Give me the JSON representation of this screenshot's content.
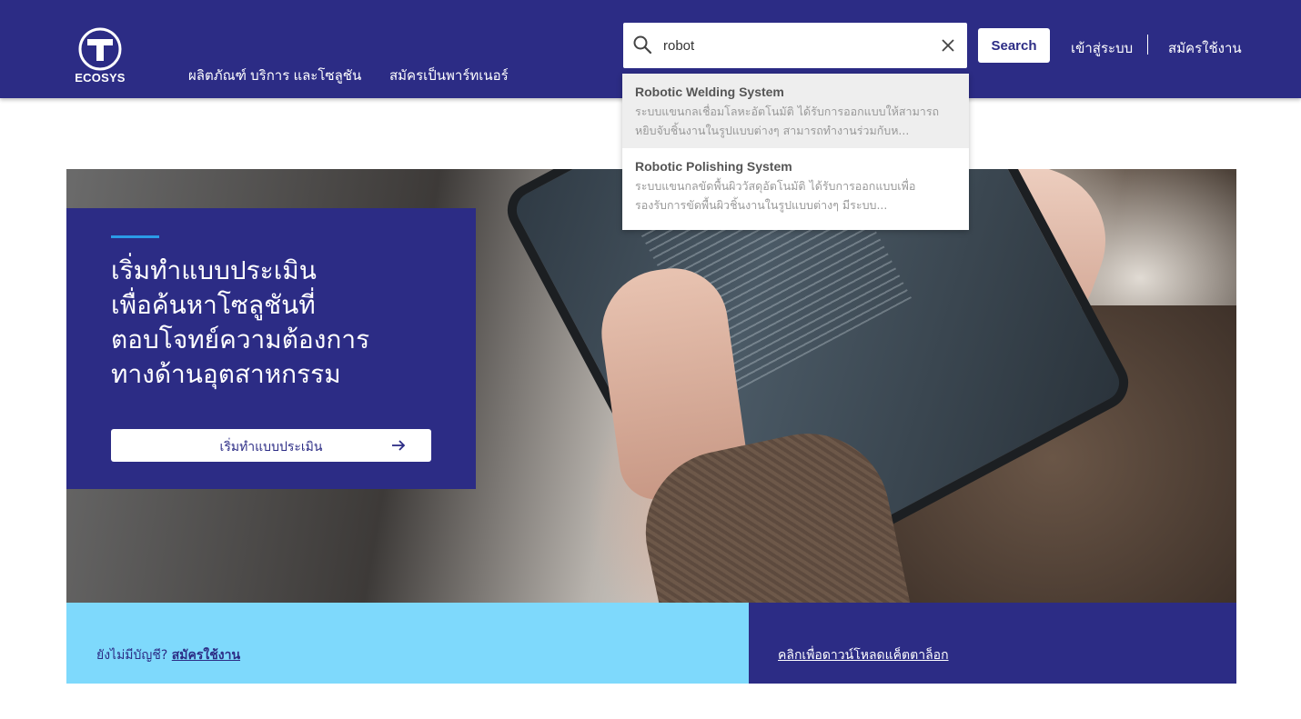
{
  "header": {
    "logo_text": "ECOSYS",
    "nav": [
      {
        "label": "ผลิตภัณฑ์ บริการ และโซลูชัน"
      },
      {
        "label": "สมัครเป็นพาร์ทเนอร์"
      }
    ],
    "search": {
      "value": "robot",
      "button_label": "Search"
    },
    "login_label": "เข้าสู่ระบบ",
    "register_label": "สมัครใช้งาน"
  },
  "suggestions": [
    {
      "title": "Robotic Welding System",
      "desc_line1": "ระบบแขนกลเชื่อมโลหะอัตโนมัติ ได้รับการออกแบบให้สามารถ",
      "desc_line2": "หยิบจับชิ้นงานในรูปแบบต่างๆ สามารถทำงานร่วมกับห..."
    },
    {
      "title": "Robotic Polishing System",
      "desc_line1": "ระบบแขนกลขัดพื้นผิววัสดุอัตโนมัติ ได้รับการออกแบบเพื่อ",
      "desc_line2": "รองรับการขัดพื้นผิวชิ้นงานในรูปแบบต่างๆ มีระบบ..."
    }
  ],
  "hero": {
    "title_lines": [
      "เริ่มทำแบบประเมิน",
      "เพื่อค้นหาโซลูชันที่",
      "ตอบโจทย์ความต้องการ",
      "ทางด้านอุตสาหกรรม"
    ],
    "cta_label": "เริ่มทำแบบประเมิน"
  },
  "bottom": {
    "no_account_text": "ยังไม่มีบัญชี?",
    "register_link": "สมัครใช้งาน",
    "catalog_link": "คลิกเพื่อดาวน์โหลดแค็ตตาล็อก"
  },
  "colors": {
    "brand": "#2c2c85",
    "accent": "#2b9be8",
    "light_blue": "#7ed9fc"
  },
  "icons": [
    "logo-icon",
    "search-icon",
    "close-icon",
    "arrow-right-icon"
  ]
}
